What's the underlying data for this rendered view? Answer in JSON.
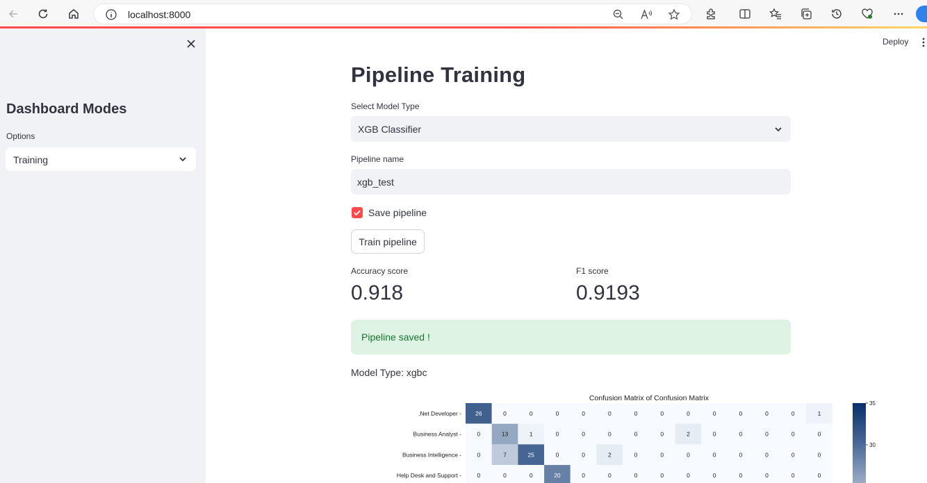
{
  "browser": {
    "url": "localhost:8000"
  },
  "sidebar": {
    "title": "Dashboard Modes",
    "options_label": "Options",
    "selected_option": "Training"
  },
  "header": {
    "deploy_label": "Deploy"
  },
  "main": {
    "title": "Pipeline Training",
    "model_type_label": "Select Model Type",
    "model_type_value": "XGB Classifier",
    "pipeline_name_label": "Pipeline name",
    "pipeline_name_value": "xgb_test",
    "save_pipeline_label": "Save pipeline",
    "save_pipeline_checked": true,
    "train_button_label": "Train pipeline",
    "metrics": [
      {
        "label": "Accuracy score",
        "value": "0.918"
      },
      {
        "label": "F1 score",
        "value": "0.9193"
      }
    ],
    "success_message": "Pipeline saved !",
    "model_type_text": "Model Type: xgbc"
  },
  "colors": {
    "accent": "#ff4b4b",
    "sidebar_bg": "#f0f2f6",
    "success_bg": "#dff3e5",
    "success_text": "#177233",
    "heat_low": "#f7fbff",
    "heat_high": "#08306b"
  },
  "chart_data": {
    "type": "heatmap",
    "title": "Confusion Matrix of Confusion Matrix",
    "row_labels": [
      ".Net Developer",
      "Business Analyst",
      "Business Intelligence",
      "Help Desk and Support"
    ],
    "columns": 14,
    "values": [
      [
        26,
        0,
        0,
        0,
        0,
        0,
        0,
        0,
        0,
        0,
        0,
        0,
        0,
        1
      ],
      [
        0,
        13,
        1,
        0,
        0,
        0,
        0,
        0,
        2,
        0,
        0,
        0,
        0,
        0
      ],
      [
        0,
        7,
        25,
        0,
        0,
        2,
        0,
        0,
        0,
        0,
        0,
        0,
        0,
        0
      ],
      [
        0,
        0,
        0,
        20,
        0,
        0,
        0,
        0,
        0,
        0,
        0,
        0,
        0,
        0
      ]
    ],
    "colorbar_ticks": [
      "35",
      "30"
    ],
    "vmax": 35
  }
}
